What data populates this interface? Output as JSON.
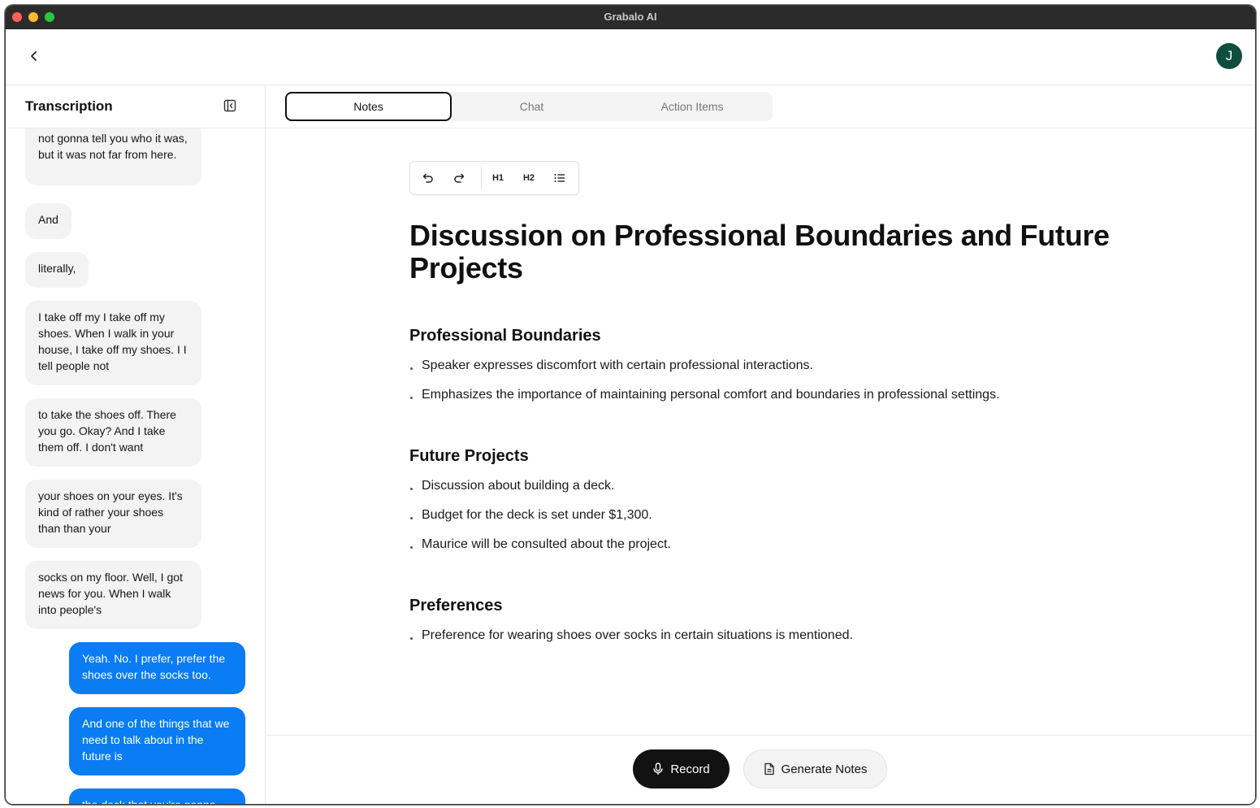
{
  "window": {
    "title": "Grabalo AI"
  },
  "header": {
    "avatar_initial": "J"
  },
  "sidebar": {
    "title": "Transcription",
    "messages": [
      {
        "speaker": "them",
        "text": "not gonna tell you who it was, but it was not far from here."
      },
      {
        "speaker": "them",
        "text": "And"
      },
      {
        "speaker": "them",
        "text": "literally,"
      },
      {
        "speaker": "them",
        "text": "I take off my I take off my shoes. When I walk in your house, I take off my shoes. I I tell people not"
      },
      {
        "speaker": "them",
        "text": "to take the shoes off. There you go. Okay? And I take them off. I don't want"
      },
      {
        "speaker": "them",
        "text": "your shoes on your eyes. It's kind of rather your shoes than than your"
      },
      {
        "speaker": "them",
        "text": "socks on my floor. Well, I got news for you. When I walk into people's"
      },
      {
        "speaker": "me",
        "text": "Yeah. No. I prefer, prefer the shoes over the socks too."
      },
      {
        "speaker": "me",
        "text": "And one of the things that we need to talk about in the future is"
      },
      {
        "speaker": "me",
        "text": "the deck that you're gonna"
      }
    ]
  },
  "tabs": [
    {
      "label": "Notes",
      "active": true
    },
    {
      "label": "Chat",
      "active": false
    },
    {
      "label": "Action Items",
      "active": false
    }
  ],
  "toolbar": {
    "h1_label": "H1",
    "h2_label": "H2"
  },
  "document": {
    "title": "Discussion on Professional Boundaries and Future Projects",
    "sections": [
      {
        "heading": "Professional Boundaries",
        "bullets": [
          "Speaker expresses discomfort with certain professional interactions.",
          "Emphasizes the importance of maintaining personal comfort and boundaries in professional settings."
        ]
      },
      {
        "heading": "Future Projects",
        "bullets": [
          "Discussion about building a deck.",
          "Budget for the deck is set under $1,300.",
          "Maurice will be consulted about the project."
        ]
      },
      {
        "heading": "Preferences",
        "bullets": [
          "Preference for wearing shoes over socks in certain situations is mentioned."
        ]
      }
    ]
  },
  "footer": {
    "record_label": "Record",
    "generate_label": "Generate Notes"
  },
  "colors": {
    "accent_blue": "#0a7cf4",
    "avatar_green": "#0f4d3f",
    "record_black": "#121212"
  }
}
